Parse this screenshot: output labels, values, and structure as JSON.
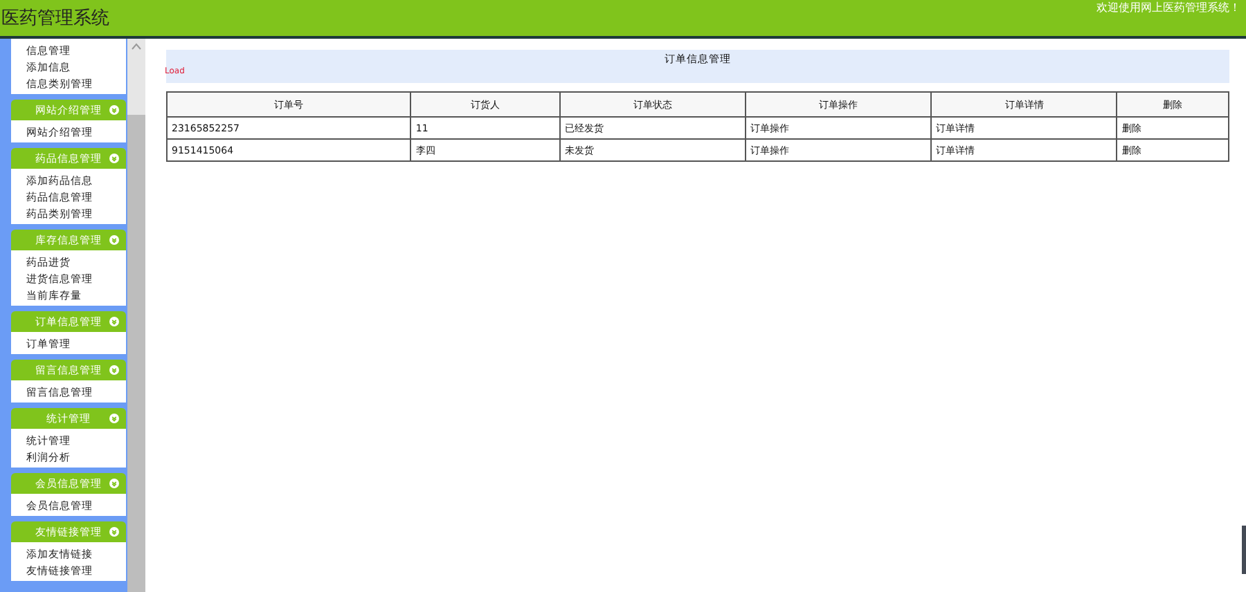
{
  "header": {
    "title": "医药管理系统",
    "welcome": "欢迎使用网上医药管理系统！"
  },
  "sidebar": {
    "groups": [
      {
        "items": [
          "信息管理",
          "添加信息",
          "信息类别管理"
        ]
      },
      {
        "title": "网站介绍管理",
        "items": [
          "网站介绍管理"
        ]
      },
      {
        "title": "药品信息管理",
        "items": [
          "添加药品信息",
          "药品信息管理",
          "药品类别管理"
        ]
      },
      {
        "title": "库存信息管理",
        "items": [
          "药品进货",
          "进货信息管理",
          "当前库存量"
        ]
      },
      {
        "title": "订单信息管理",
        "items": [
          "订单管理"
        ]
      },
      {
        "title": "留言信息管理",
        "items": [
          "留言信息管理"
        ]
      },
      {
        "title": "统计管理",
        "items": [
          "统计管理",
          "利润分析"
        ]
      },
      {
        "title": "会员信息管理",
        "items": [
          "会员信息管理"
        ]
      },
      {
        "title": "友情链接管理",
        "items": [
          "添加友情链接",
          "友情链接管理"
        ]
      }
    ]
  },
  "main": {
    "title": "订单信息管理",
    "load_label": "Load",
    "table": {
      "columns": [
        "订单号",
        "订货人",
        "订单状态",
        "订单操作",
        "订单详情",
        "删除"
      ],
      "rows": [
        [
          "23165852257",
          "11",
          "已经发货",
          "订单操作",
          "订单详情",
          "删除"
        ],
        [
          "9151415064",
          "李四",
          "未发货",
          "订单操作",
          "订单详情",
          "删除"
        ]
      ]
    }
  }
}
